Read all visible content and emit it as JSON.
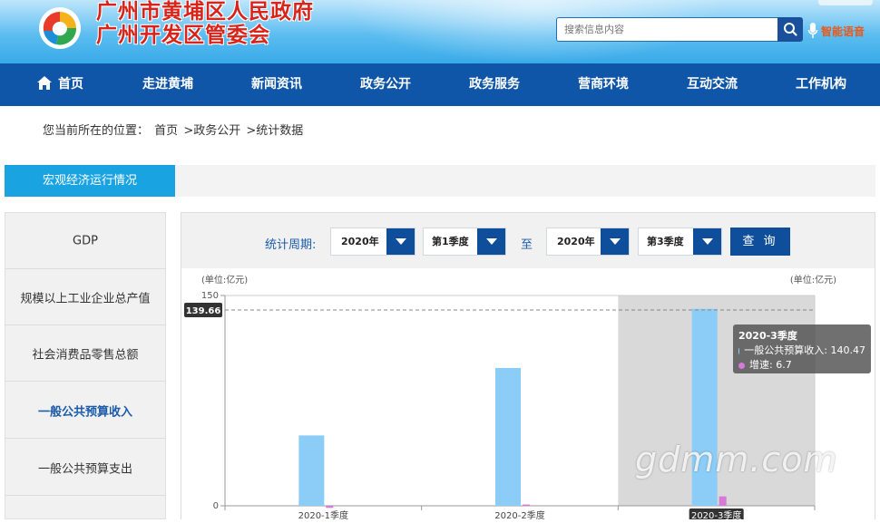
{
  "header": {
    "logo_line1": "广州市黄埔区人民政府",
    "logo_line2": "广州开发区管委会",
    "search_placeholder": "搜索信息内容",
    "voice_label": "智能语音"
  },
  "nav": {
    "items": [
      "首页",
      "走进黄埔",
      "新闻资讯",
      "政务公开",
      "政务服务",
      "营商环境",
      "互动交流",
      "工作机构"
    ]
  },
  "breadcrumb": {
    "prefix": "您当前所在的位置：",
    "items": [
      "首页",
      ">政务公开",
      ">统计数据"
    ]
  },
  "section": {
    "tab_label": "宏观经济运行情况"
  },
  "sidebar": {
    "items": [
      {
        "label": "GDP"
      },
      {
        "label": "规模以上工业企业总产值"
      },
      {
        "label": "社会消费品零售总额"
      },
      {
        "label": "一般公共预算收入",
        "active": true
      },
      {
        "label": "一般公共预算支出"
      }
    ]
  },
  "filter": {
    "period_label": "统计周期:",
    "start_year": "2020年",
    "start_quarter": "第1季度",
    "to_label": "至",
    "end_year": "2020年",
    "end_quarter": "第3季度",
    "query_label": "查 询"
  },
  "chart_data": {
    "type": "bar",
    "categories": [
      "2020-1季度",
      "2020-2季度",
      "2020-3季度"
    ],
    "series": [
      {
        "name": "一般公共预算收入",
        "values": [
          50.2,
          98.3,
          140.47
        ],
        "color": "#8ccdf7"
      },
      {
        "name": "增速",
        "values": [
          -1.5,
          0.9,
          6.7
        ],
        "color": "#d779d6"
      }
    ],
    "ylabel_left": "(单位:亿元)",
    "ylabel_right": "(单位:亿元)",
    "y_ticks": [
      "150",
      "0"
    ],
    "ylim": [
      0,
      150
    ],
    "crosshair_value": "139.66",
    "highlighted_category": "2020-3季度",
    "tooltip": {
      "title": "2020-3季度",
      "line1": "一般公共预算收入: 140.47",
      "line2": "增速: 6.7"
    }
  },
  "watermark": "gdmm.com"
}
